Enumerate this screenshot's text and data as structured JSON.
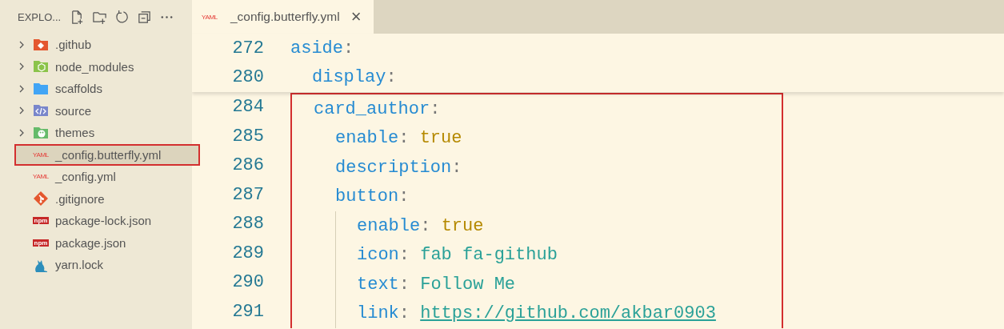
{
  "sidebar": {
    "title": "EXPLO...",
    "items": [
      {
        "label": ".github",
        "kind": "folder",
        "expanded": false,
        "selected": false,
        "highlighted": false
      },
      {
        "label": "node_modules",
        "kind": "folder",
        "expanded": false,
        "selected": false,
        "highlighted": false
      },
      {
        "label": "scaffolds",
        "kind": "folder",
        "expanded": false,
        "selected": false,
        "highlighted": false
      },
      {
        "label": "source",
        "kind": "folder",
        "expanded": false,
        "selected": false,
        "highlighted": false
      },
      {
        "label": "themes",
        "kind": "folder",
        "expanded": false,
        "selected": false,
        "highlighted": false
      },
      {
        "label": "_config.butterfly.yml",
        "kind": "file",
        "icon_text": "YAML",
        "selected": true,
        "highlighted": true
      },
      {
        "label": "_config.yml",
        "kind": "file",
        "icon_text": "YAML",
        "selected": false,
        "highlighted": false
      },
      {
        "label": ".gitignore",
        "kind": "file",
        "selected": false,
        "highlighted": false
      },
      {
        "label": "package-lock.json",
        "kind": "file",
        "icon_text": "npm",
        "selected": false,
        "highlighted": false
      },
      {
        "label": "package.json",
        "kind": "file",
        "icon_text": "npm",
        "selected": false,
        "highlighted": false
      },
      {
        "label": "yarn.lock",
        "kind": "file",
        "selected": false,
        "highlighted": false
      }
    ]
  },
  "tabs": [
    {
      "label": "_config.butterfly.yml",
      "icon_text": "YAML",
      "close": "×",
      "selected": true
    }
  ],
  "editor": {
    "sticky_lines": [
      {
        "number": "272",
        "key": "aside",
        "sep": ":",
        "children": [
          {
            "number": "280",
            "key": "display",
            "sep": ":"
          }
        ]
      }
    ],
    "lines": [
      {
        "number": "284",
        "key": "card_author",
        "sep": ":",
        "boxed": true,
        "children": [
          {
            "number": "285",
            "key": "enable",
            "sep": ":",
            "value": "true",
            "kind": "bool"
          },
          {
            "number": "286",
            "key": "description",
            "sep": ":"
          },
          {
            "number": "287",
            "key": "button",
            "sep": ":",
            "children": [
              {
                "number": "288",
                "key": "enable",
                "sep": ":",
                "value": "true",
                "kind": "bool"
              },
              {
                "number": "289",
                "key": "icon",
                "sep": ":",
                "value": "fab fa-github",
                "kind": "string"
              },
              {
                "number": "290",
                "key": "text",
                "sep": ":",
                "value": "Follow Me",
                "kind": "string"
              },
              {
                "number": "291",
                "key": "link",
                "sep": ":",
                "value": "https://github.com/akbar0903",
                "kind": "link"
              }
            ]
          }
        ]
      }
    ]
  }
}
